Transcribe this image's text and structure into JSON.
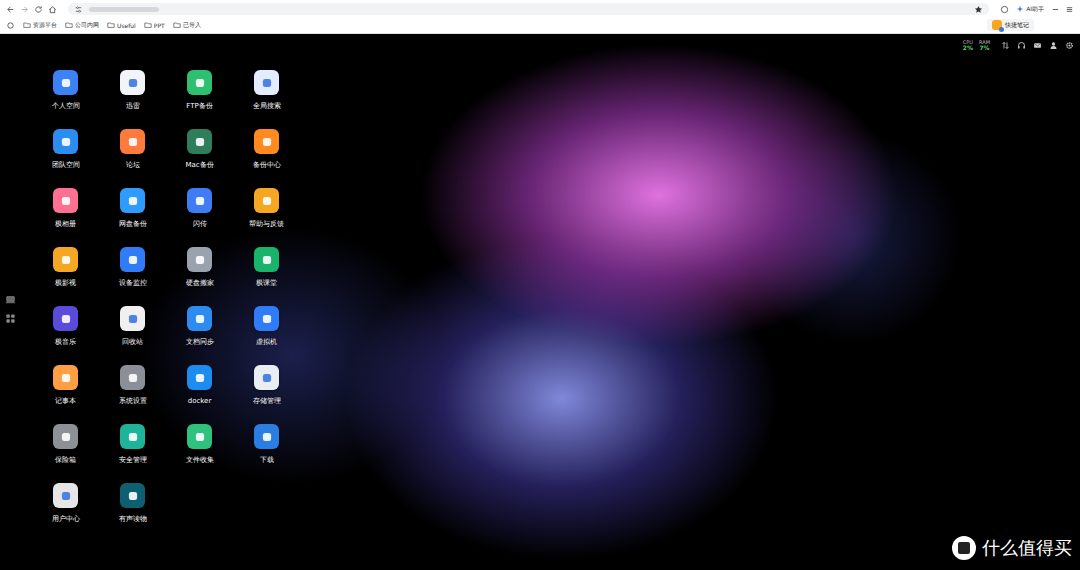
{
  "browser": {
    "bookmarks": [
      {
        "label": "资源平台"
      },
      {
        "label": "公司内网"
      },
      {
        "label": "Useful"
      },
      {
        "label": "PPT"
      },
      {
        "label": "已导入"
      }
    ],
    "ai_button": "AI助手",
    "note_button": "快捷笔记"
  },
  "status": {
    "cpu_label": "CPU",
    "cpu": "2%",
    "ram_label": "RAM",
    "ram": "7%"
  },
  "apps": [
    {
      "label": "个人空间",
      "color": "#3b82f6"
    },
    {
      "label": "迅雷",
      "color": "#f2f4f8"
    },
    {
      "label": "FTP备份",
      "color": "#2fbf71"
    },
    {
      "label": "全局搜索",
      "color": "#e4ecff"
    },
    {
      "label": "团队空间",
      "color": "#2d8cf0"
    },
    {
      "label": "论坛",
      "color": "#ff7a3d"
    },
    {
      "label": "Mac备份",
      "color": "#2e7d5b"
    },
    {
      "label": "备份中心",
      "color": "#ff8a1f"
    },
    {
      "label": "极相册",
      "color": "#ff6f91"
    },
    {
      "label": "网盘备份",
      "color": "#2f9bff"
    },
    {
      "label": "闪传",
      "color": "#3f7bf2"
    },
    {
      "label": "帮助与反馈",
      "color": "#f5a623"
    },
    {
      "label": "极影视",
      "color": "#f5a623"
    },
    {
      "label": "设备监控",
      "color": "#2f7cf6"
    },
    {
      "label": "硬盘搬家",
      "color": "#9aa3ad"
    },
    {
      "label": "极课堂",
      "color": "#19b36b"
    },
    {
      "label": "极音乐",
      "color": "#5b4bdb"
    },
    {
      "label": "回收站",
      "color": "#f0f0f0"
    },
    {
      "label": "文档同步",
      "color": "#2d8cf0"
    },
    {
      "label": "虚拟机",
      "color": "#2f7cf6"
    },
    {
      "label": "记事本",
      "color": "#ff9f43"
    },
    {
      "label": "系统设置",
      "color": "#8a8f98"
    },
    {
      "label": "docker",
      "color": "#1d8cf0"
    },
    {
      "label": "存储管理",
      "color": "#e9eef3"
    },
    {
      "label": "保险箱",
      "color": "#8d9196"
    },
    {
      "label": "安全管理",
      "color": "#1fb39a"
    },
    {
      "label": "文件收集",
      "color": "#2ec27e"
    },
    {
      "label": "下载",
      "color": "#2a7de1"
    },
    {
      "label": "用户中心",
      "color": "#e6e6e6"
    },
    {
      "label": "有声读物",
      "color": "#0f5f73"
    }
  ],
  "watermark": "什么值得买"
}
